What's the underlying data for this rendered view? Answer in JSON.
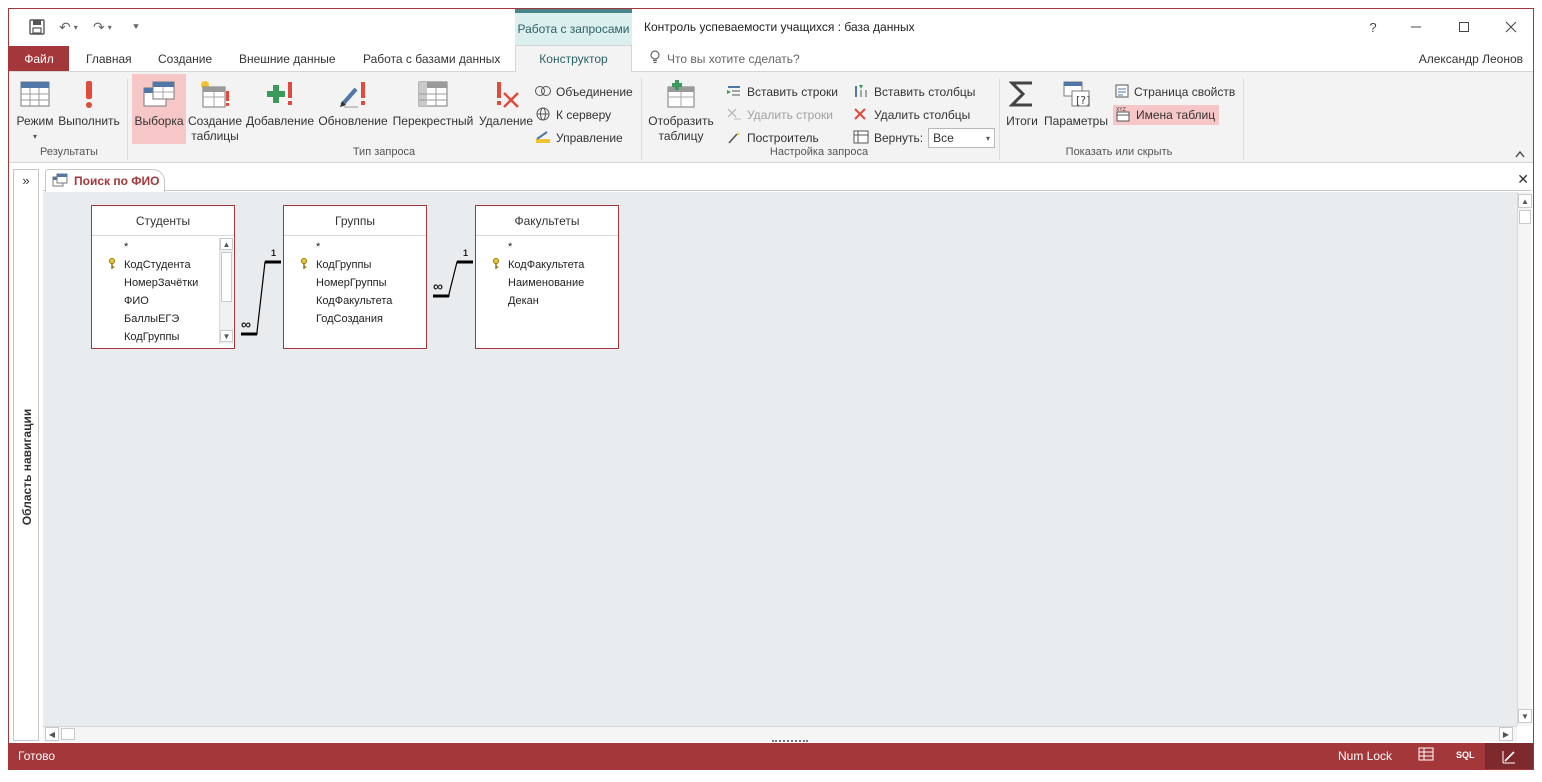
{
  "window": {
    "title": "Контроль успеваемости учащихся : база данных",
    "context_tab_group": "Работа с запросами",
    "help": "?"
  },
  "tabs": {
    "file": "Файл",
    "items": [
      "Главная",
      "Создание",
      "Внешние данные",
      "Работа с базами данных"
    ],
    "active": "Конструктор",
    "tell_me": "Что вы хотите сделать?",
    "user": "Александр Леонов"
  },
  "ribbon": {
    "results": {
      "label": "Результаты",
      "mode": "Режим",
      "run": "Выполнить"
    },
    "query_type": {
      "label": "Тип запроса",
      "select": "Выборка",
      "make_table_1": "Создание",
      "make_table_2": "таблицы",
      "append": "Добавление",
      "update": "Обновление",
      "crosstab": "Перекрестный",
      "delete": "Удаление",
      "union": "Объединение",
      "pass_through": "К серверу",
      "data_definition": "Управление"
    },
    "query_setup": {
      "label": "Настройка запроса",
      "show_table_1": "Отобразить",
      "show_table_2": "таблицу",
      "insert_rows": "Вставить строки",
      "delete_rows": "Удалить строки",
      "builder": "Построитель",
      "insert_columns": "Вставить столбцы",
      "delete_columns": "Удалить столбцы",
      "return_label": "Вернуть:",
      "return_value": "Все"
    },
    "show_hide": {
      "label": "Показать или скрыть",
      "totals": "Итоги",
      "parameters": "Параметры",
      "property_sheet": "Страница свойств",
      "table_names": "Имена таблиц"
    }
  },
  "nav_pane": {
    "label": "Область навигации",
    "toggle": "»"
  },
  "document": {
    "tab_title": "Поиск по ФИО",
    "close": "✕"
  },
  "tables": {
    "students": {
      "title": "Студенты",
      "fields": [
        "*",
        "КодСтудента",
        "НомерЗачётки",
        "ФИО",
        "БаллыЕГЭ",
        "КодГруппы"
      ]
    },
    "groups": {
      "title": "Группы",
      "fields": [
        "*",
        "КодГруппы",
        "НомерГруппы",
        "КодФакультета",
        "ГодСоздания"
      ]
    },
    "faculties": {
      "title": "Факультеты",
      "fields": [
        "*",
        "КодФакультета",
        "Наименование",
        "Декан"
      ]
    }
  },
  "relationships": {
    "one_label": "1",
    "many_label": "∞"
  },
  "status": {
    "ready": "Готово",
    "numlock": "Num Lock",
    "sql": "SQL"
  },
  "colors": {
    "accent": "#a4373a",
    "context_tab": "#49858b",
    "selected": "#f7c6c7",
    "canvas": "#e9ecef"
  }
}
